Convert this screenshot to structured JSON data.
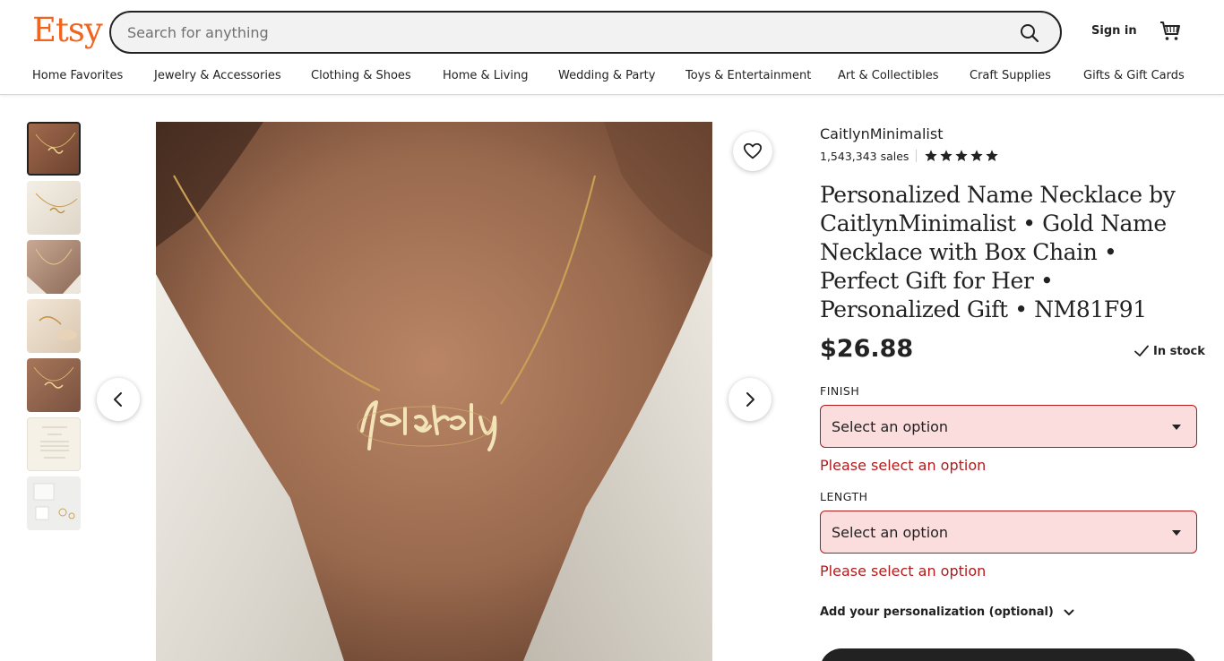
{
  "header": {
    "logo": "Etsy",
    "search_placeholder": "Search for anything",
    "sign_in": "Sign in"
  },
  "nav": {
    "items": [
      "Home Favorites",
      "Jewelry & Accessories",
      "Clothing & Shoes",
      "Home & Living",
      "Wedding & Party",
      "Toys & Entertainment",
      "Art & Collectibles",
      "Craft Supplies",
      "Gifts & Gift Cards"
    ]
  },
  "gallery": {
    "thumbnail_count": 7,
    "active_index": 0,
    "main_image_text": "Blakely"
  },
  "listing": {
    "shop_name": "CaitlynMinimalist",
    "sales": "1,543,343 sales",
    "rating_stars": 5,
    "title": "Personalized Name Necklace by CaitlynMinimalist • Gold Name Necklace with Box Chain • Perfect Gift for Her • Personalized Gift • NM81F91",
    "price": "$26.88",
    "stock": "In stock",
    "finish": {
      "label": "FINISH",
      "value": "Select an option",
      "error": "Please select an option"
    },
    "length": {
      "label": "LENGTH",
      "value": "Select an option",
      "error": "Please select an option"
    },
    "personalization": "Add your personalization (optional)"
  },
  "colors": {
    "brand": "#f1641e",
    "error": "#b31b1b",
    "error_bg": "#fbdddd",
    "text": "#222222"
  },
  "icons": {
    "search": "search-icon",
    "cart": "cart-icon",
    "favorite": "heart-icon",
    "prev": "chevron-left-icon",
    "next": "chevron-right-icon",
    "in_stock": "check-icon",
    "expand": "chevron-down-icon"
  }
}
